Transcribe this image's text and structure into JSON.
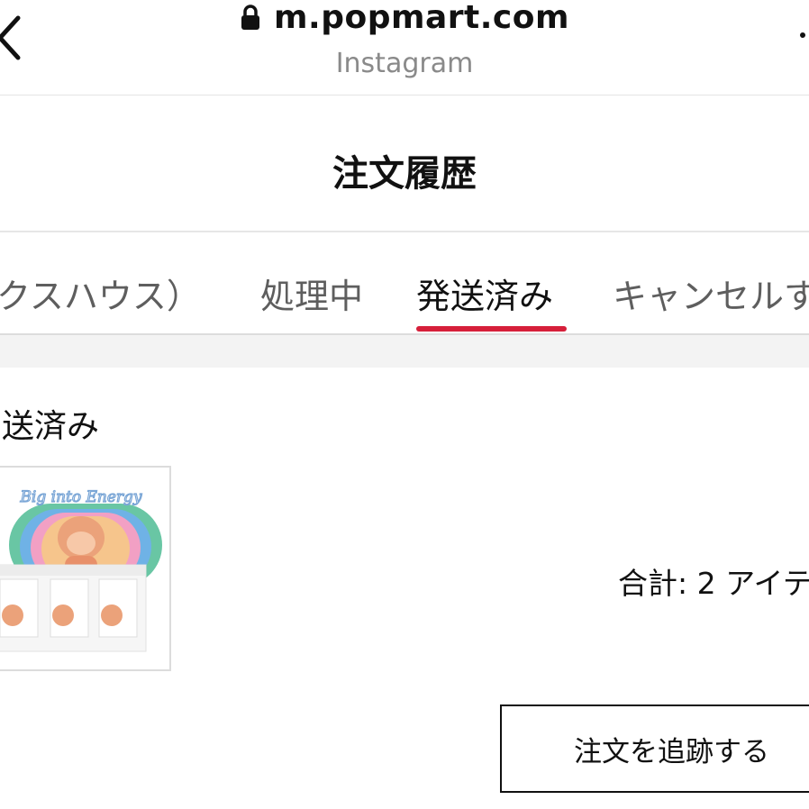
{
  "browser": {
    "url": "m.popmart.com",
    "source": "Instagram",
    "back_icon": "back-chevron-icon",
    "lock_icon": "lock-icon",
    "more_icon": "more-icon"
  },
  "page": {
    "title": "注文履歴"
  },
  "tabs": [
    {
      "label": "クスハウス）",
      "active": false
    },
    {
      "label": "処理中",
      "active": false
    },
    {
      "label": "発送済み",
      "active": true
    },
    {
      "label": "キャンセルす",
      "active": false
    }
  ],
  "order": {
    "status": "送済み",
    "product_image_label": "Big into Energy",
    "total": "合計: 2 アイテ",
    "track_button": "注文を追跡する"
  },
  "colors": {
    "accent": "#d61f3a",
    "text_primary": "#111111",
    "text_secondary": "#5e5e5e",
    "divider": "#e6e6e6",
    "section_gap": "#f3f3f3"
  }
}
